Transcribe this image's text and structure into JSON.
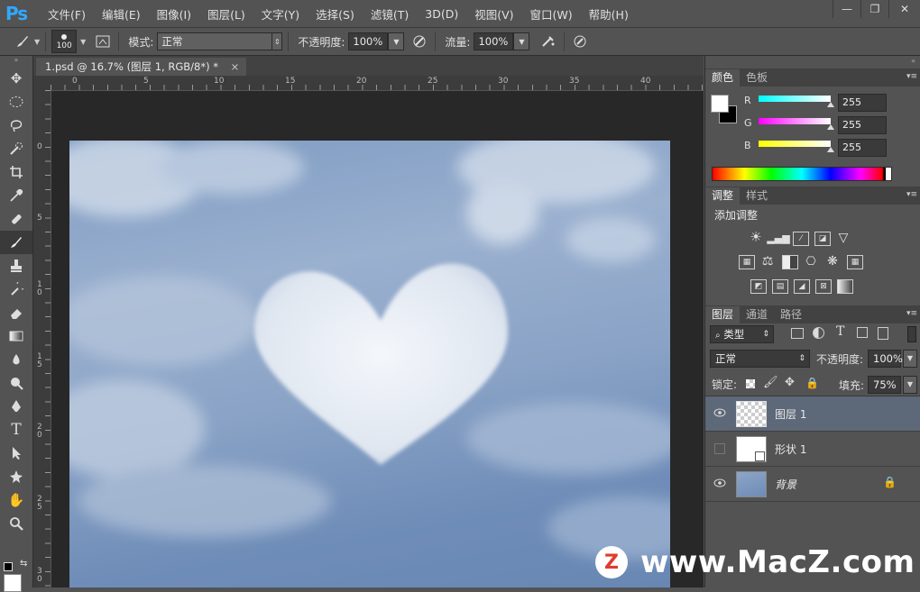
{
  "app": {
    "logo": "Ps"
  },
  "menu": [
    "文件(F)",
    "编辑(E)",
    "图像(I)",
    "图层(L)",
    "文字(Y)",
    "选择(S)",
    "滤镜(T)",
    "3D(D)",
    "视图(V)",
    "窗口(W)",
    "帮助(H)"
  ],
  "window_controls": {
    "minimize": "—",
    "restore": "❐",
    "close": "✕"
  },
  "options": {
    "brush_size": "100",
    "mode_label": "模式:",
    "mode_value": "正常",
    "opacity_label": "不透明度:",
    "opacity_value": "100%",
    "flow_label": "流量:",
    "flow_value": "100%"
  },
  "document": {
    "tab_title": "1.psd @ 16.7% (图层 1, RGB/8*) *",
    "tab_close": "×",
    "hruler": [
      "0",
      "5",
      "10",
      "15",
      "20",
      "25",
      "30",
      "35",
      "40"
    ],
    "vruler": [
      "0",
      "5",
      "1\n0",
      "1\n5",
      "2\n0",
      "2\n5",
      "3\n0"
    ]
  },
  "color_panel": {
    "tabs": [
      "颜色",
      "色板"
    ],
    "r_label": "R",
    "r_value": "255",
    "g_label": "G",
    "g_value": "255",
    "b_label": "B",
    "b_value": "255"
  },
  "adjust_panel": {
    "tabs": [
      "调整",
      "样式"
    ],
    "heading": "添加调整"
  },
  "layers_panel": {
    "tabs": [
      "图层",
      "通道",
      "路径"
    ],
    "filter_kind": "类型",
    "blend_mode": "正常",
    "opacity_label": "不透明度:",
    "opacity_value": "100%",
    "lock_label": "锁定:",
    "fill_label": "填充:",
    "fill_value": "75%",
    "layers": [
      {
        "name": "图层 1",
        "visible": true,
        "selected": true
      },
      {
        "name": "形状 1",
        "visible": false,
        "selected": false
      },
      {
        "name": "背景",
        "visible": true,
        "selected": false
      }
    ]
  },
  "watermark": {
    "badge": "Z",
    "text": "www.MacZ.com"
  },
  "colors": {
    "accent": "#31a8ff",
    "selected_layer": "#5d6878",
    "panel_bg": "#535353",
    "workspace": "#282828"
  }
}
